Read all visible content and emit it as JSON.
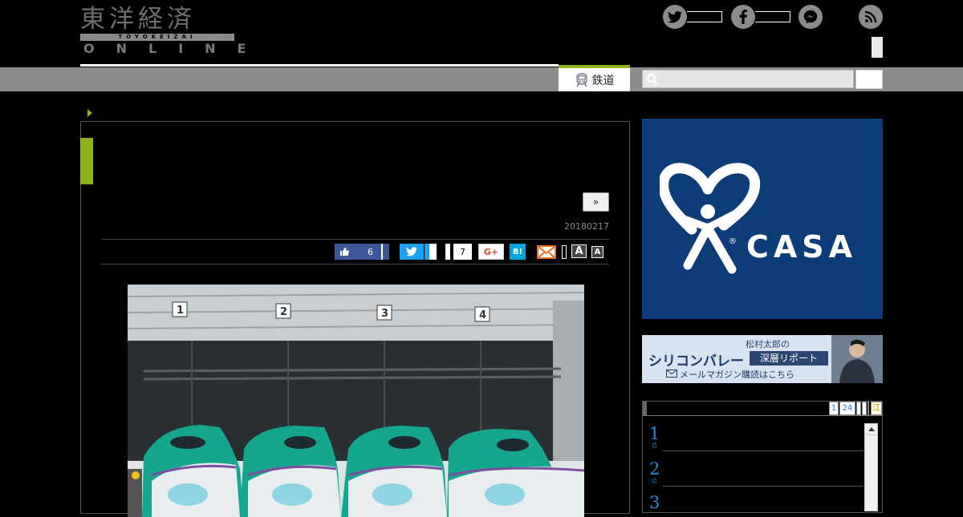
{
  "header": {
    "logo_jp": "東洋経済",
    "logo_en": "TOYOKEIZAI",
    "logo_online": "ONLINE",
    "social": [
      {
        "icon": "twitter-icon",
        "glyph": "t"
      },
      {
        "icon": "facebook-icon",
        "glyph": "f"
      },
      {
        "icon": "messenger-icon",
        "glyph": "~"
      }
    ],
    "rss_icon": "rss-icon"
  },
  "nav": {
    "active_tab": "鉄道",
    "search_placeholder": ""
  },
  "article": {
    "next_label": "»",
    "date": "20180217",
    "share": {
      "like_count": "6",
      "hatena_count": "7",
      "google_label": "G+",
      "hatena_label": "B!",
      "font_large": "A",
      "font_small": "A"
    }
  },
  "sidebar": {
    "ad_brand": "CASA",
    "ad2_line1": "松村太郎の",
    "ad2_line2": "シリコンバレー",
    "ad2_tag": "深層リポート",
    "ad2_line3": "メールマガジン購読はこちら",
    "ranking_tabs": [
      "1",
      "24"
    ],
    "ranking_extra_tab": "江",
    "ranking_items": [
      {
        "rank": "1",
        "suffix": "位"
      },
      {
        "rank": "2",
        "suffix": "位"
      },
      {
        "rank": "3",
        "suffix": "位"
      }
    ]
  },
  "colors": {
    "accent_green": "#8cb31a",
    "nav_gray": "#8c8c8c",
    "twitter_blue": "#1da1f2",
    "like_blue": "#3b5998",
    "rank_blue": "#2a8ad8",
    "ad_navy": "#0c3d78"
  }
}
